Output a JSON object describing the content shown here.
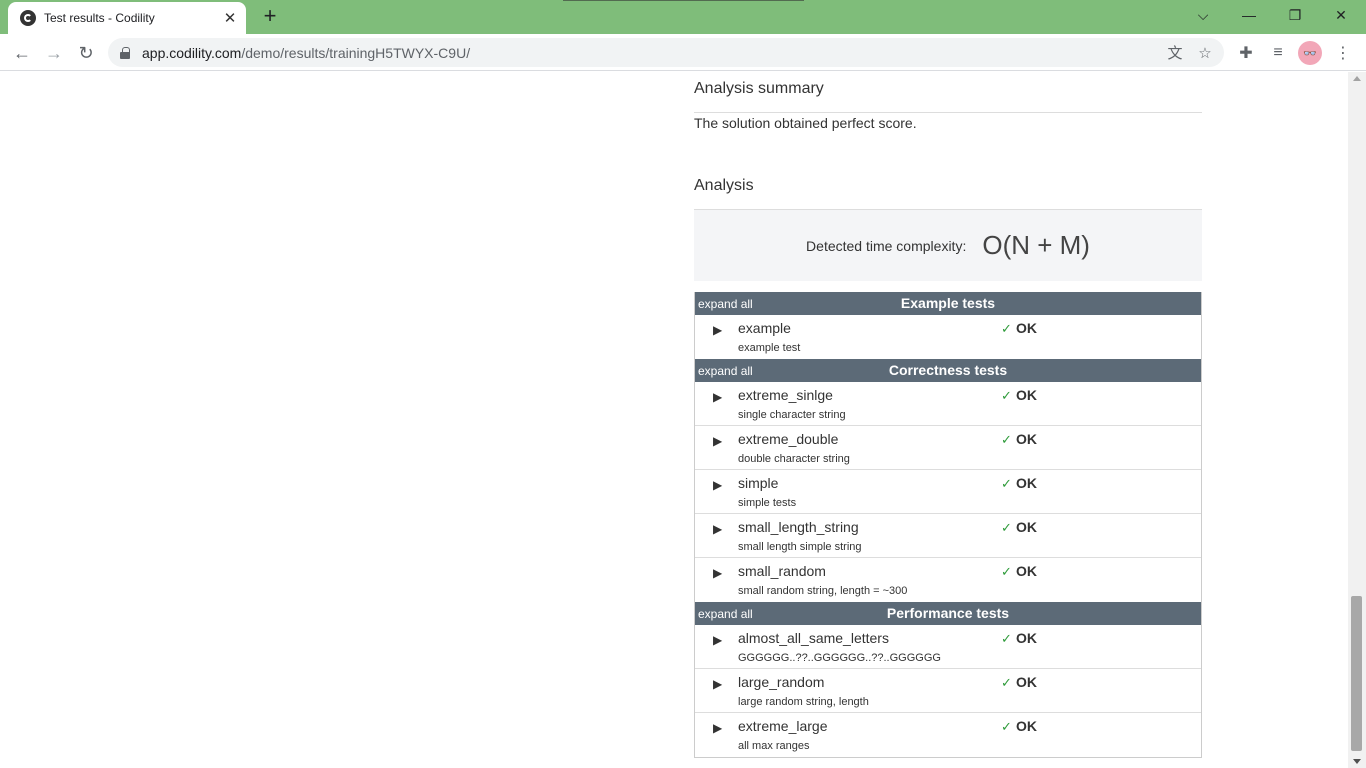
{
  "browser": {
    "tab_title": "Test results - Codility",
    "url_host": "app.codility.com",
    "url_path": "/demo/results/trainingH5TWYX-C9U/",
    "avatar_text": "👓"
  },
  "page": {
    "analysis_summary_heading": "Analysis summary",
    "analysis_summary_text": "The solution obtained perfect score.",
    "analysis_heading": "Analysis",
    "complexity_label": "Detected time complexity:",
    "complexity_value": "O(N + M)"
  },
  "test_groups": [
    {
      "expand_label": "expand all",
      "title": "Example tests",
      "tests": [
        {
          "name": "example",
          "description": "example test",
          "check": "✓",
          "status": "OK"
        }
      ]
    },
    {
      "expand_label": "expand all",
      "title": "Correctness tests",
      "tests": [
        {
          "name": "extreme_sinlge",
          "description": "single character string",
          "check": "✓",
          "status": "OK"
        },
        {
          "name": "extreme_double",
          "description": "double character string",
          "check": "✓",
          "status": "OK"
        },
        {
          "name": "simple",
          "description": "simple tests",
          "check": "✓",
          "status": "OK"
        },
        {
          "name": "small_length_string",
          "description": "small length simple string",
          "check": "✓",
          "status": "OK"
        },
        {
          "name": "small_random",
          "description": "small random string, length = ~300",
          "check": "✓",
          "status": "OK"
        }
      ]
    },
    {
      "expand_label": "expand all",
      "title": "Performance tests",
      "tests": [
        {
          "name": "almost_all_same_letters",
          "description": "GGGGGG..??..GGGGGG..??..GGGGGG",
          "check": "✓",
          "status": "OK"
        },
        {
          "name": "large_random",
          "description": "large random string, length",
          "check": "✓",
          "status": "OK"
        },
        {
          "name": "extreme_large",
          "description": "all max ranges",
          "check": "✓",
          "status": "OK"
        }
      ]
    }
  ],
  "colors": {
    "chrome_green": "#7fbd7a",
    "group_header": "#5c6a77",
    "ok_check": "#2e9b3a"
  }
}
